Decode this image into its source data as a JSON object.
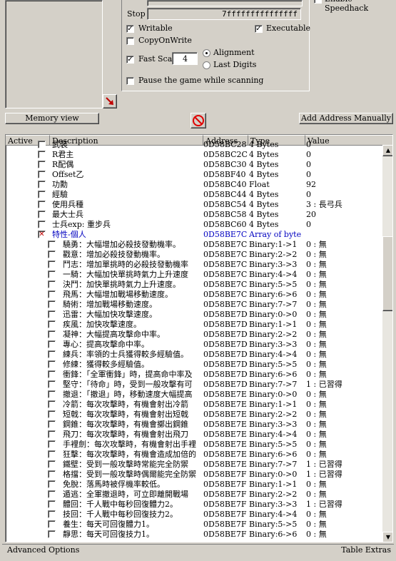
{
  "scan_options": {
    "speedhack_label": "Enable Speedhack",
    "stop_label": "Stop",
    "stop_value": "7fffffffffffffff",
    "writable_label": "Writable",
    "executable_label": "Executable",
    "copyonwrite_label": "CopyOnWrite",
    "fastscan_label": "Fast Scan",
    "fastscan_value": "4",
    "alignment_label": "Alignment",
    "last_digits_label": "Last Digits",
    "pause_label": "Pause the game while scanning"
  },
  "toolbar": {
    "memory_view_label": "Memory view",
    "add_address_label": "Add Address Manually"
  },
  "table": {
    "columns": [
      "Active",
      "Description",
      "Address",
      "Type",
      "Value"
    ],
    "rows": [
      {
        "desc": "武裝",
        "address": "0D58BC28",
        "type": "4 Bytes",
        "value": "0",
        "indent": 1
      },
      {
        "desc": "R君主",
        "address": "0D58BC2C",
        "type": "4 Bytes",
        "value": "0",
        "indent": 1
      },
      {
        "desc": "R配偶",
        "address": "0D58BC30",
        "type": "4 Bytes",
        "value": "0",
        "indent": 1
      },
      {
        "desc": "Offset乙",
        "address": "0D58BF40",
        "type": "4 Bytes",
        "value": "0",
        "indent": 1
      },
      {
        "desc": "功勳",
        "address": "0D58BC40",
        "type": "Float",
        "value": "92",
        "indent": 1
      },
      {
        "desc": "經驗",
        "address": "0D58BC44",
        "type": "4 Bytes",
        "value": "0",
        "indent": 1
      },
      {
        "desc": "使用兵種",
        "address": "0D58BC54",
        "type": "4 Bytes",
        "value": "3 : 長弓兵",
        "indent": 1
      },
      {
        "desc": "最大士兵",
        "address": "0D58BC58",
        "type": "4 Bytes",
        "value": "20",
        "indent": 1
      },
      {
        "desc": "士兵exp: 重步兵",
        "address": "0D58BC60",
        "type": "4 Bytes",
        "value": "0",
        "indent": 1
      },
      {
        "desc": "特性-個人",
        "address": "0D58BE7C",
        "type": "Array of byte",
        "value": "",
        "indent": 1,
        "group": true
      },
      {
        "desc": "驍勇：大幅增加必殺技發動機率。",
        "address": "0D58BE7C",
        "type": "Binary:1->1",
        "value": "0 : 無",
        "indent": 2
      },
      {
        "desc": "戳意：增加必殺技發動機率。",
        "address": "0D58BE7C",
        "type": "Binary:2->2",
        "value": "0 : 無",
        "indent": 2
      },
      {
        "desc": "鬥志：增加單挑時的必殺技發動機率",
        "address": "0D58BE7C",
        "type": "Binary:3->3",
        "value": "0 : 無",
        "indent": 2
      },
      {
        "desc": "一騎：大幅加快單挑時氣力上升速度",
        "address": "0D58BE7C",
        "type": "Binary:4->4",
        "value": "0 : 無",
        "indent": 2
      },
      {
        "desc": "決鬥：加快單挑時氣力上升速度。",
        "address": "0D58BE7C",
        "type": "Binary:5->5",
        "value": "0 : 無",
        "indent": 2
      },
      {
        "desc": "飛馬：大幅增加戰場移動速度。",
        "address": "0D58BE7C",
        "type": "Binary:6->6",
        "value": "0 : 無",
        "indent": 2
      },
      {
        "desc": "騎術：增加戰場移動速度。",
        "address": "0D58BE7C",
        "type": "Binary:7->7",
        "value": "0 : 無",
        "indent": 2
      },
      {
        "desc": "迅雷：大幅加快攻擊速度。",
        "address": "0D58BE7D",
        "type": "Binary:0->0",
        "value": "0 : 無",
        "indent": 2
      },
      {
        "desc": "疾風：加快攻擊速度。",
        "address": "0D58BE7D",
        "type": "Binary:1->1",
        "value": "0 : 無",
        "indent": 2
      },
      {
        "desc": "凝神：大幅提高攻擊命中率。",
        "address": "0D58BE7D",
        "type": "Binary:2->2",
        "value": "0 : 無",
        "indent": 2
      },
      {
        "desc": "專心：提高攻擊命中率。",
        "address": "0D58BE7D",
        "type": "Binary:3->3",
        "value": "0 : 無",
        "indent": 2
      },
      {
        "desc": "練兵：率領的士兵獲得較多經驗值。",
        "address": "0D58BE7D",
        "type": "Binary:4->4",
        "value": "0 : 無",
        "indent": 2
      },
      {
        "desc": "修練：獲得較多經驗值。",
        "address": "0D58BE7D",
        "type": "Binary:5->5",
        "value": "0 : 無",
        "indent": 2
      },
      {
        "desc": "衝鋒：「全軍衝鋒」時，提高命中率及",
        "address": "0D58BE7D",
        "type": "Binary:6->6",
        "value": "0 : 無",
        "indent": 2
      },
      {
        "desc": "堅守：「待命」時，受到一般攻擊有可",
        "address": "0D58BE7D",
        "type": "Binary:7->7",
        "value": "1 : 已習得",
        "indent": 2
      },
      {
        "desc": "撤退：「撤退」時，移動速度大幅提高",
        "address": "0D58BE7E",
        "type": "Binary:0->0",
        "value": "0 : 無",
        "indent": 2
      },
      {
        "desc": "冷箭：每次攻擊時，有機會射出冷箭",
        "address": "0D58BE7E",
        "type": "Binary:1->1",
        "value": "0 : 無",
        "indent": 2
      },
      {
        "desc": "短戟：每次攻擊時，有機會射出短戟",
        "address": "0D58BE7E",
        "type": "Binary:2->2",
        "value": "0 : 無",
        "indent": 2
      },
      {
        "desc": "鋼錐：每次攻擊時，有機會擲出鋼錐",
        "address": "0D58BE7E",
        "type": "Binary:3->3",
        "value": "0 : 無",
        "indent": 2
      },
      {
        "desc": "飛刀：每次攻擊時，有機會射出飛刀",
        "address": "0D58BE7E",
        "type": "Binary:4->4",
        "value": "0 : 無",
        "indent": 2
      },
      {
        "desc": "手裡劍：每次攻擊時，有機會射出手裡",
        "address": "0D58BE7E",
        "type": "Binary:5->5",
        "value": "0 : 無",
        "indent": 2
      },
      {
        "desc": "狂擊：每次攻擊時，有機會造成加倍的",
        "address": "0D58BE7E",
        "type": "Binary:6->6",
        "value": "0 : 無",
        "indent": 2
      },
      {
        "desc": "鐵壁：受到一般攻擊時常能完全防禦",
        "address": "0D58BE7E",
        "type": "Binary:7->7",
        "value": "1 : 已習得",
        "indent": 2
      },
      {
        "desc": "格擋：受到一般攻擊時偶爾能完全防禦",
        "address": "0D58BE7F",
        "type": "Binary:0->0",
        "value": "1 : 已習得",
        "indent": 2
      },
      {
        "desc": "免脫：落馬時被俘機率較低。",
        "address": "0D58BE7F",
        "type": "Binary:1->1",
        "value": "0 : 無",
        "indent": 2
      },
      {
        "desc": "遁逃：全軍撤退時，可立即離開戰場",
        "address": "0D58BE7F",
        "type": "Binary:2->2",
        "value": "0 : 無",
        "indent": 2
      },
      {
        "desc": "體回：千人戰中每秒回復體力2。",
        "address": "0D58BE7F",
        "type": "Binary:3->3",
        "value": "1 : 已習得",
        "indent": 2
      },
      {
        "desc": "技回：千人戰中每秒回復技力2。",
        "address": "0D58BE7F",
        "type": "Binary:4->4",
        "value": "0 : 無",
        "indent": 2
      },
      {
        "desc": "養生：每天可回復體力1。",
        "address": "0D58BE7F",
        "type": "Binary:5->5",
        "value": "0 : 無",
        "indent": 2
      },
      {
        "desc": "靜思：每天可回復技力1。",
        "address": "0D58BE7F",
        "type": "Binary:6->6",
        "value": "0 : 無",
        "indent": 2
      }
    ]
  },
  "statusbar": {
    "left": "Advanced Options",
    "right": "Table Extras"
  },
  "colors": {
    "group_text": "#0000c0",
    "row_text": "#000000",
    "checked_mark": "#c00000"
  }
}
